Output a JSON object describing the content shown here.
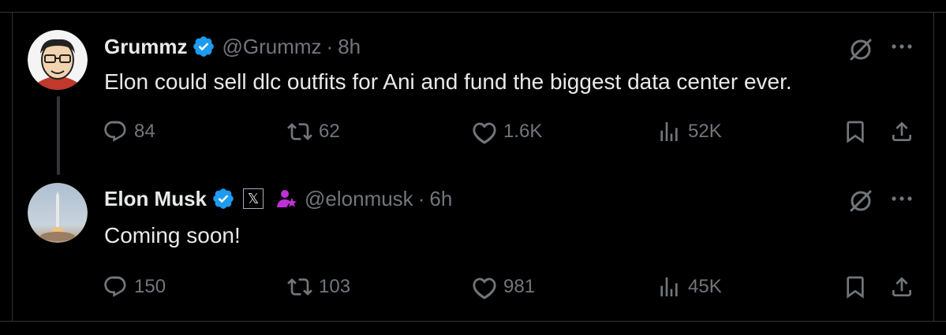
{
  "colors": {
    "background": "#000000",
    "text": "#e7e9ea",
    "muted": "#71767b",
    "verified": "#1d9bf0",
    "affiliate": "#c030d8",
    "border": "#2f3336"
  },
  "tweets": [
    {
      "name": "Grummz",
      "handle": "@Grummz",
      "separator": "·",
      "time": "8h",
      "text": "Elon could sell dlc outfits for Ani and fund the biggest data center ever.",
      "replies": "84",
      "retweets": "62",
      "likes": "1.6K",
      "views": "52K"
    },
    {
      "name": "Elon Musk",
      "x_badge": "𝕏",
      "handle": "@elonmusk",
      "separator": "·",
      "time": "6h",
      "text": "Coming soon!",
      "replies": "150",
      "retweets": "103",
      "likes": "981",
      "views": "45K"
    }
  ],
  "icons": [
    "reply-icon",
    "retweet-icon",
    "like-icon",
    "views-icon",
    "bookmark-icon",
    "share-icon",
    "grok-icon",
    "more-icon",
    "verified-icon"
  ]
}
